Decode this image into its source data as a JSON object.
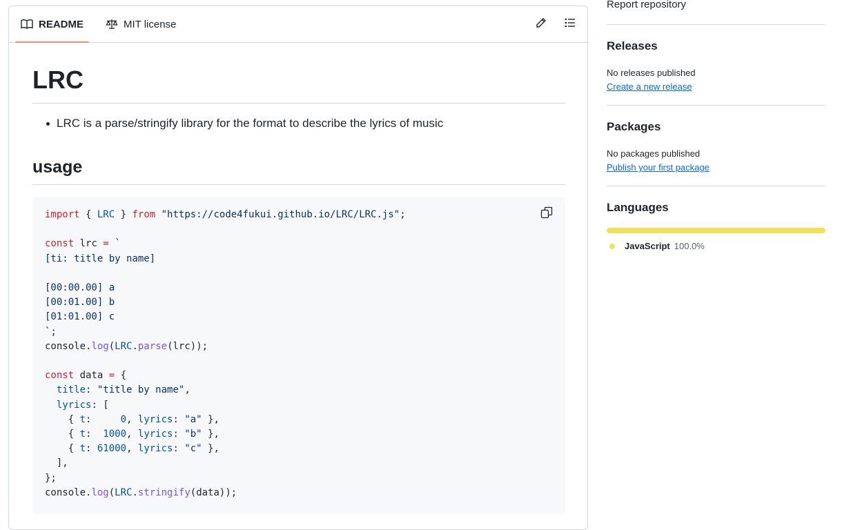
{
  "tabs": [
    {
      "label": "README",
      "icon": "book-icon",
      "active": true
    },
    {
      "label": "MIT license",
      "icon": "law-icon",
      "active": false
    }
  ],
  "toolbar": {
    "edit_icon": "pencil-icon",
    "outline_icon": "list-icon"
  },
  "readme": {
    "title": "LRC",
    "bullet": "LRC is a parse/stringify library for the format to describe the lyrics of music",
    "usage_heading": "usage",
    "code_language": "javascript",
    "copy_icon": "copy-icon",
    "code_lines": [
      "import { LRC } from \"https://code4fukui.github.io/LRC/LRC.js\";",
      "",
      "const lrc = `",
      "[ti: title by name]",
      "",
      "[00:00.00] a",
      "[00:01.00] b",
      "[01:01.00] c",
      "`;",
      "console.log(LRC.parse(lrc));",
      "",
      "const data = {",
      "  title: \"title by name\",",
      "  lyrics: [",
      "    { t:     0, lyrics: \"a\" },",
      "    { t:  1000, lyrics: \"b\" },",
      "    { t: 61000, lyrics: \"c\" },",
      "  ],",
      "};",
      "console.log(LRC.stringify(data));"
    ]
  },
  "sidebar": {
    "report_link": "Report repository",
    "releases": {
      "heading": "Releases",
      "status": "No releases published",
      "link": "Create a new release"
    },
    "packages": {
      "heading": "Packages",
      "status": "No packages published",
      "link": "Publish your first package"
    },
    "languages": {
      "heading": "Languages",
      "items": [
        {
          "name": "JavaScript",
          "percent": "100.0%",
          "color": "#f1e05a",
          "fraction": 1.0
        }
      ]
    }
  },
  "colors": {
    "border": "#d1d9e0",
    "active_tab_underline": "#fd8c73",
    "link": "#0969da",
    "code_bg": "#f6f8fa"
  }
}
